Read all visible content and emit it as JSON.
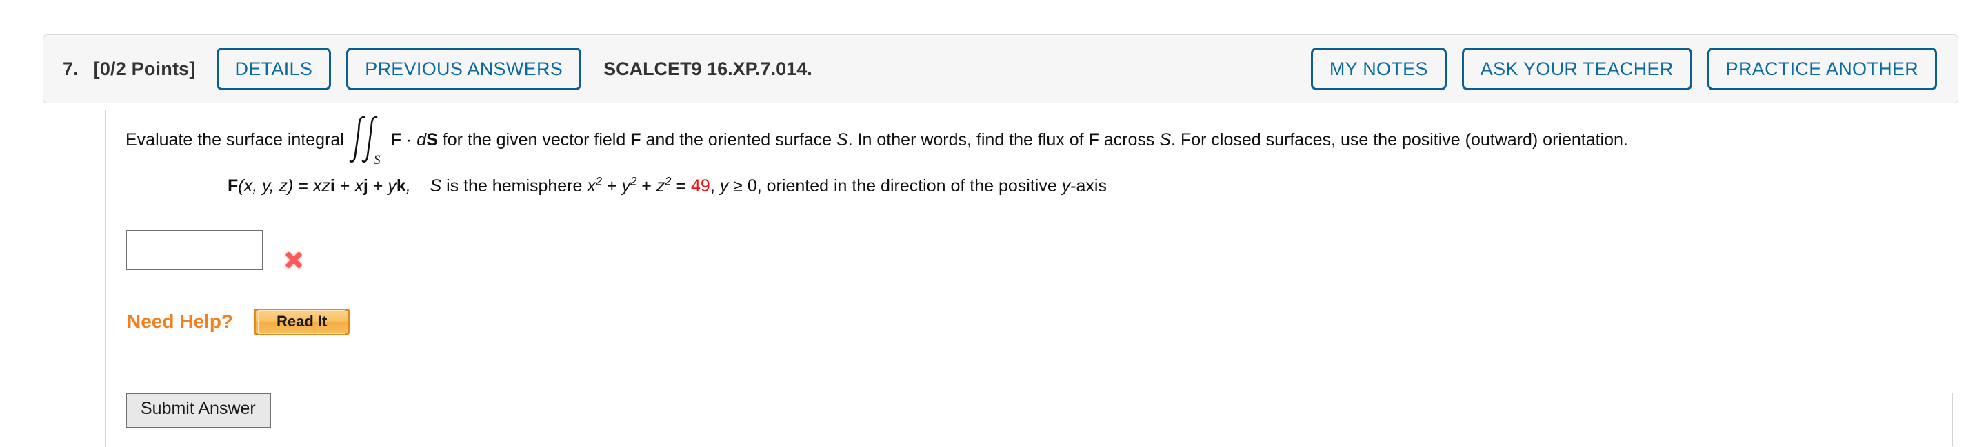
{
  "header": {
    "question_number": "7.",
    "points": "[0/2 Points]",
    "details_label": "DETAILS",
    "previous_answers_label": "PREVIOUS ANSWERS",
    "question_code": "SCALCET9 16.XP.7.014.",
    "my_notes_label": "MY NOTES",
    "ask_your_teacher_label": "ASK YOUR TEACHER",
    "practice_another_label": "PRACTICE ANOTHER",
    "accent_color": "#0b5e91"
  },
  "problem": {
    "prompt_part1": "Evaluate the surface integral",
    "integral_subscript": "S",
    "integrand_f": "F",
    "integrand_dot": "·",
    "integrand_ds_d": "d",
    "integrand_ds_s": "S",
    "prompt_part2_a": "for the given vector field",
    "prompt_part2_f": "F",
    "prompt_part2_b": "and the oriented surface",
    "prompt_part2_s": "S",
    "prompt_part3_a": ". In other words, find the flux of",
    "prompt_part3_f": "F",
    "prompt_part3_b": "across",
    "prompt_part3_s": "S",
    "prompt_part4": ". For closed surfaces, use the positive (outward) orientation.",
    "equation": {
      "field_name": "F",
      "field_args": "(x, y, z)",
      "equals": "=",
      "term1_scalar": "xz",
      "term1_unit": "i",
      "plus1": "+",
      "term2_scalar": "x",
      "term2_unit": "j",
      "plus2": "+",
      "term3_scalar": "y",
      "term3_unit": "k",
      "comma": ",",
      "surface_s": "S",
      "surface_desc": "is the hemisphere",
      "var_x": "x",
      "var_y": "y",
      "var_z": "z",
      "exponent": "2",
      "plus_a": "+",
      "plus_b": "+",
      "eq_sign": "=",
      "radius_squared": "49",
      "condition_comma": ",",
      "condition_var": "y",
      "condition": "≥ 0,",
      "orientation_text": "oriented in the direction of the positive",
      "orientation_var": "y",
      "orientation_axis": "-axis",
      "highlight_color": "#ee1111"
    }
  },
  "answer": {
    "value": "",
    "placeholder": "",
    "status_icon": "x-mark-incorrect",
    "status_color": "#fa5a5a"
  },
  "help": {
    "need_help_label": "Need Help?",
    "read_it_label": "Read It",
    "label_color": "#f08020"
  },
  "footer": {
    "submit_label": "Submit Answer"
  }
}
